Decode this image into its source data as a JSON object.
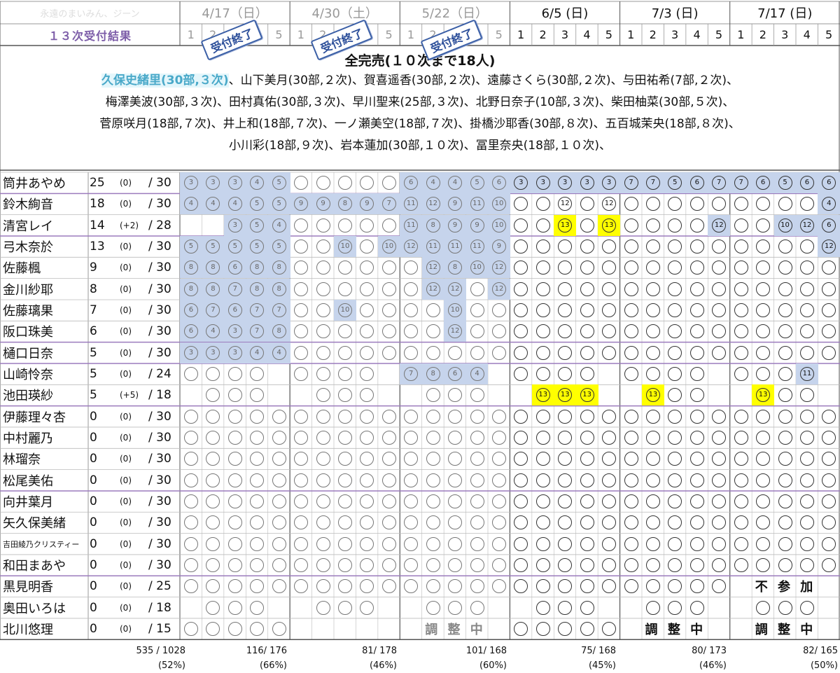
{
  "header": {
    "faded_text": "永遠のまいみん、ジーン",
    "title": "１３次受付結果",
    "slot_numbers": [
      "1",
      "2",
      "3",
      "4",
      "5"
    ],
    "dates": [
      {
        "label": "4/17（日）",
        "closed": true
      },
      {
        "label": "4/30（土）",
        "closed": true
      },
      {
        "label": "5/22（日）",
        "closed": true
      },
      {
        "label": "6/5 (日)",
        "closed": false
      },
      {
        "label": "7/3 (日)",
        "closed": false
      },
      {
        "label": "7/17 (日)",
        "closed": false
      }
    ],
    "closed_stamp": "受付終了"
  },
  "notice": {
    "title": "全完売(１０次まで18人)",
    "highlight": "久保史緒里(30部,３次)",
    "line1_rest": "、山下美月(30部,２次)、賀喜遥香(30部,２次)、遠藤さくら(30部,２次)、与田祐希(7部,２次)、",
    "lines": [
      "梅澤美波(30部,３次)、田村真佑(30部,３次)、早川聖来(25部,３次)、北野日奈子(10部,３次)、柴田柚菜(30部,５次)、",
      "菅原咲月(18部,７次)、井上和(18部,７次)、一ノ瀬美空(18部,７次)、掛橋沙耶香(30部,８次)、五百城茉央(18部,８次)、",
      "小川彩(18部,９次)、岩本蓮加(30部,１０次)、冨里奈央(18部,１０次)、"
    ]
  },
  "legend": {
    "s": "shaded = sold in earlier round",
    "y": "yellow = sold in round 13",
    "c": "circle"
  },
  "members": [
    {
      "name": "筒井あやめ",
      "count": "25",
      "delta": "(0)",
      "slots": "/ 30",
      "cells": "s3 s3 s3 s4 s5|c c c c c|s6 s4 s4 s5 s6|s3 s3 s3 s3 s3|s7 s7 s5 s6 s7|s7 s6 s5 s6 s6"
    },
    {
      "name": "鈴木絢音",
      "count": "18",
      "delta": "(0)",
      "slots": "/ 30",
      "cells": "s4 s4 s4 s5 s5|s9 s9 s8 s9 s7|s11 s12 s9 s11 s10|c c 12 c 12|c c c c c|c c c c s4"
    },
    {
      "name": "清宮レイ",
      "count": "14",
      "delta": "(+2)",
      "slots": "/ 28",
      "cells": "x x s3 s5 s4|c c c c c|s11 s8 s9 s9 s10|c c y13 c y13|c c c c s12|c c s10 s12 s6"
    },
    {
      "name": "弓木奈於",
      "count": "13",
      "delta": "(0)",
      "slots": "/ 30",
      "cells": "s5 s5 s5 s5 s5|c c s10 c s10|s12 s11 s11 s11 s9|c c c c c|c c c c c|c c c c s12"
    },
    {
      "name": "佐藤楓",
      "count": "9",
      "delta": "(0)",
      "slots": "/ 30",
      "cells": "s8 s8 s6 s8 s8|c c c c c|c s12 s8 s10 s12|c c c c c|c c c c c|c c c c c"
    },
    {
      "name": "金川紗耶",
      "count": "8",
      "delta": "(0)",
      "slots": "/ 30",
      "cells": "s8 s8 s7 s8 s8|c c c c c|c s12 s12 c s12|c c c c c|c c c c c|c c c c c"
    },
    {
      "name": "佐藤璃果",
      "count": "7",
      "delta": "(0)",
      "slots": "/ 30",
      "cells": "s6 s7 s6 s7 s7|c c s10 c c|c c s10 c c|c c c c c|c c c c c|c c c c c"
    },
    {
      "name": "阪口珠美",
      "count": "6",
      "delta": "(0)",
      "slots": "/ 30",
      "cells": "s6 s4 s3 s7 s8|c c c c c|c c s12 c c|c c c c c|c c c c c|c c c c c"
    },
    {
      "name": "樋口日奈",
      "count": "5",
      "delta": "(0)",
      "slots": "/ 30",
      "cells": "s3 s3 s3 s4 s4|c c c c c|c c c c c|c c c c c|c c c c c|c c c c c"
    },
    {
      "name": "山崎怜奈",
      "count": "5",
      "delta": "(0)",
      "slots": "/ 24",
      "cells": "c c c c x|c c c c x|s7 s8 s6 s4 x|c c c c x|c c c c x|c c c s11 x"
    },
    {
      "name": "池田瑛紗",
      "count": "5",
      "delta": "(+5)",
      "slots": "/ 18",
      "cells": "x c c c x|x c c c x|x c c c x|x y13 y13 y13 x|x y13 c c x|x y13 c c x"
    },
    {
      "name": "伊藤理々杏",
      "count": "0",
      "delta": "(0)",
      "slots": "/ 30",
      "cells": "c c c c c|c c c c c|c c c c c|c c c c c|c c c c c|c c c c c"
    },
    {
      "name": "中村麗乃",
      "count": "0",
      "delta": "(0)",
      "slots": "/ 30",
      "cells": "c c c c c|c c c c c|c c c c c|c c c c c|c c c c c|c c c c c"
    },
    {
      "name": "林瑠奈",
      "count": "0",
      "delta": "(0)",
      "slots": "/ 30",
      "cells": "c c c c c|c c c c c|c c c c c|c c c c c|c c c c c|c c c c c"
    },
    {
      "name": "松尾美佑",
      "count": "0",
      "delta": "(0)",
      "slots": "/ 30",
      "cells": "c c c c c|c c c c c|c c c c c|c c c c c|c c c c c|c c c c c"
    },
    {
      "name": "向井葉月",
      "count": "0",
      "delta": "(0)",
      "slots": "/ 30",
      "cells": "c c c c c|c c c c c|c c c c c|c c c c c|c c c c c|c c c c c"
    },
    {
      "name": "矢久保美緒",
      "count": "0",
      "delta": "(0)",
      "slots": "/ 30",
      "cells": "c c c c c|c c c c c|c c c c c|c c c c c|c c c c c|c c c c c"
    },
    {
      "name": "吉田綾乃クリスティー",
      "count": "0",
      "delta": "(0)",
      "slots": "/ 30",
      "small": true,
      "cells": "c c c c c|c c c c c|c c c c c|c c c c c|c c c c c|c c c c c"
    },
    {
      "name": "和田まあや",
      "count": "0",
      "delta": "(0)",
      "slots": "/ 30",
      "cells": "c c c c c|c c c c c|c c c c c|c c c c c|c c c c c|c c c c c"
    },
    {
      "name": "黒見明香",
      "count": "0",
      "delta": "(0)",
      "slots": "/ 25",
      "cells": "c c c c c|c c c c c|c c c c c|c c c c c|c c c c c|x x x x x",
      "overlay": [
        null,
        null,
        null,
        null,
        null,
        "不 参 加"
      ]
    },
    {
      "name": "奥田いろは",
      "count": "0",
      "delta": "(0)",
      "slots": "/ 18",
      "cells": "x c c c x|x c c c x|x c c c x|x c c c x|x c c c x|x c c c x"
    },
    {
      "name": "北川悠理",
      "count": "0",
      "delta": "(0)",
      "slots": "/ 15",
      "cells": "c c c c c|x x x x x|x x x x x|c c c c c|x x x x x|x x x x x",
      "overlay": [
        null,
        null,
        "調 整 中",
        null,
        "調 整 中",
        "調 整 中"
      ]
    }
  ],
  "totals": [
    {
      "total": "535 / 1028",
      "pct": "(52%)"
    },
    {
      "total": "116/ 176",
      "pct": "(66%)"
    },
    {
      "total": "81/ 178",
      "pct": "(46%)"
    },
    {
      "total": "101/ 168",
      "pct": "(60%)"
    },
    {
      "total": "75/ 168",
      "pct": "(45%)"
    },
    {
      "total": "80/ 173",
      "pct": "(46%)"
    },
    {
      "total": "82/ 165",
      "pct": "(50%)"
    }
  ],
  "colors": {
    "shaded": "#c6d4ec",
    "yellow": "#ffff00",
    "grid": "#999999",
    "group_line": "#9b7bbd",
    "title": "#7c5ca8",
    "stamp": "#2c4f9a",
    "highlight_bg": "#e4f6fb",
    "highlight_fg": "#4aa9c9"
  }
}
